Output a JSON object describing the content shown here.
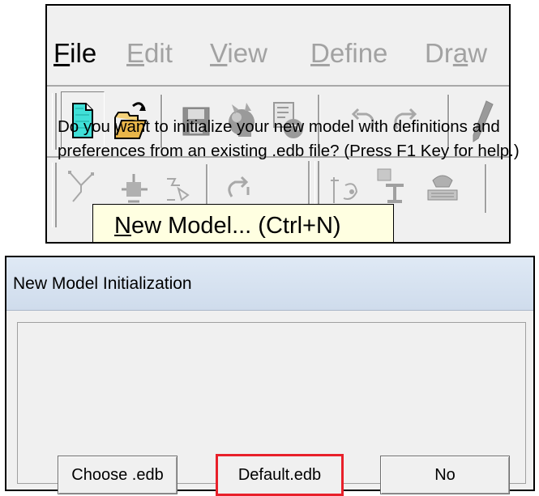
{
  "menu": {
    "items": [
      {
        "label": "File",
        "enabled": true
      },
      {
        "label": "Edit",
        "enabled": false
      },
      {
        "label": "View",
        "enabled": false
      },
      {
        "label": "Define",
        "enabled": false
      },
      {
        "label": "Draw",
        "enabled": false
      }
    ]
  },
  "toolbar_top": {
    "icons": [
      "new-model-icon",
      "open-icon",
      "save-icon",
      "print-icon",
      "export-icon",
      "undo-icon",
      "redo-icon",
      "pencil-icon"
    ]
  },
  "toolbar_bottom": {
    "icons": [
      "draw-frame-icon",
      "assign-icon",
      "restraint-icon",
      "refresh-icon",
      "section-icon",
      "property-icon",
      "keyboard-icon"
    ]
  },
  "tooltip": {
    "text": "New Model... (Ctrl+N)"
  },
  "dialog": {
    "title": "New Model Initialization",
    "message_line1": "Do you want to initialize your new model with definitions and",
    "message_line2": "preferences from an existing .edb file? (Press F1 Key for help.)",
    "buttons": {
      "choose": "Choose .edb",
      "default": "Default.edb",
      "no": "No"
    },
    "highlight_color": "#e8202a"
  }
}
